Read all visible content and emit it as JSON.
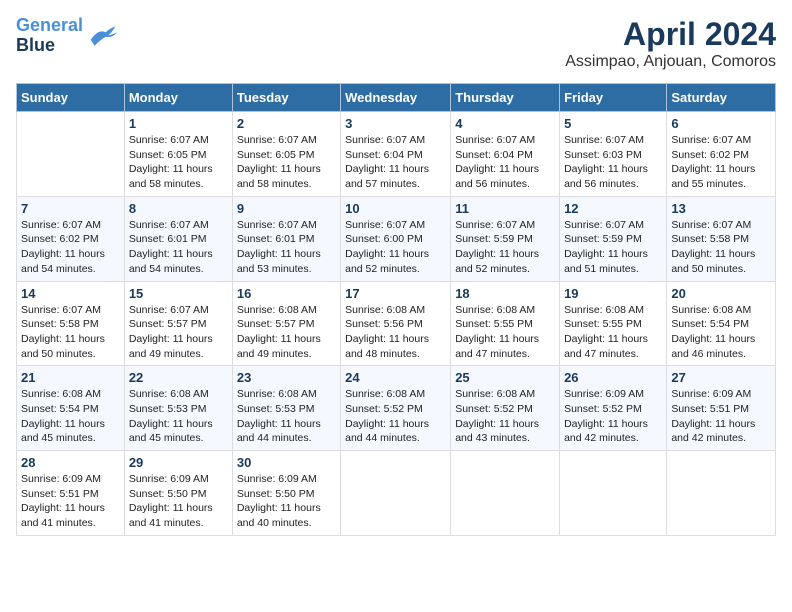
{
  "logo": {
    "line1": "General",
    "line2": "Blue"
  },
  "title": "April 2024",
  "subtitle": "Assimpao, Anjouan, Comoros",
  "days_of_week": [
    "Sunday",
    "Monday",
    "Tuesday",
    "Wednesday",
    "Thursday",
    "Friday",
    "Saturday"
  ],
  "weeks": [
    [
      {
        "day": "",
        "sunrise": "",
        "sunset": "",
        "daylight": ""
      },
      {
        "day": "1",
        "sunrise": "Sunrise: 6:07 AM",
        "sunset": "Sunset: 6:05 PM",
        "daylight": "Daylight: 11 hours and 58 minutes."
      },
      {
        "day": "2",
        "sunrise": "Sunrise: 6:07 AM",
        "sunset": "Sunset: 6:05 PM",
        "daylight": "Daylight: 11 hours and 58 minutes."
      },
      {
        "day": "3",
        "sunrise": "Sunrise: 6:07 AM",
        "sunset": "Sunset: 6:04 PM",
        "daylight": "Daylight: 11 hours and 57 minutes."
      },
      {
        "day": "4",
        "sunrise": "Sunrise: 6:07 AM",
        "sunset": "Sunset: 6:04 PM",
        "daylight": "Daylight: 11 hours and 56 minutes."
      },
      {
        "day": "5",
        "sunrise": "Sunrise: 6:07 AM",
        "sunset": "Sunset: 6:03 PM",
        "daylight": "Daylight: 11 hours and 56 minutes."
      },
      {
        "day": "6",
        "sunrise": "Sunrise: 6:07 AM",
        "sunset": "Sunset: 6:02 PM",
        "daylight": "Daylight: 11 hours and 55 minutes."
      }
    ],
    [
      {
        "day": "7",
        "sunrise": "Sunrise: 6:07 AM",
        "sunset": "Sunset: 6:02 PM",
        "daylight": "Daylight: 11 hours and 54 minutes."
      },
      {
        "day": "8",
        "sunrise": "Sunrise: 6:07 AM",
        "sunset": "Sunset: 6:01 PM",
        "daylight": "Daylight: 11 hours and 54 minutes."
      },
      {
        "day": "9",
        "sunrise": "Sunrise: 6:07 AM",
        "sunset": "Sunset: 6:01 PM",
        "daylight": "Daylight: 11 hours and 53 minutes."
      },
      {
        "day": "10",
        "sunrise": "Sunrise: 6:07 AM",
        "sunset": "Sunset: 6:00 PM",
        "daylight": "Daylight: 11 hours and 52 minutes."
      },
      {
        "day": "11",
        "sunrise": "Sunrise: 6:07 AM",
        "sunset": "Sunset: 5:59 PM",
        "daylight": "Daylight: 11 hours and 52 minutes."
      },
      {
        "day": "12",
        "sunrise": "Sunrise: 6:07 AM",
        "sunset": "Sunset: 5:59 PM",
        "daylight": "Daylight: 11 hours and 51 minutes."
      },
      {
        "day": "13",
        "sunrise": "Sunrise: 6:07 AM",
        "sunset": "Sunset: 5:58 PM",
        "daylight": "Daylight: 11 hours and 50 minutes."
      }
    ],
    [
      {
        "day": "14",
        "sunrise": "Sunrise: 6:07 AM",
        "sunset": "Sunset: 5:58 PM",
        "daylight": "Daylight: 11 hours and 50 minutes."
      },
      {
        "day": "15",
        "sunrise": "Sunrise: 6:07 AM",
        "sunset": "Sunset: 5:57 PM",
        "daylight": "Daylight: 11 hours and 49 minutes."
      },
      {
        "day": "16",
        "sunrise": "Sunrise: 6:08 AM",
        "sunset": "Sunset: 5:57 PM",
        "daylight": "Daylight: 11 hours and 49 minutes."
      },
      {
        "day": "17",
        "sunrise": "Sunrise: 6:08 AM",
        "sunset": "Sunset: 5:56 PM",
        "daylight": "Daylight: 11 hours and 48 minutes."
      },
      {
        "day": "18",
        "sunrise": "Sunrise: 6:08 AM",
        "sunset": "Sunset: 5:55 PM",
        "daylight": "Daylight: 11 hours and 47 minutes."
      },
      {
        "day": "19",
        "sunrise": "Sunrise: 6:08 AM",
        "sunset": "Sunset: 5:55 PM",
        "daylight": "Daylight: 11 hours and 47 minutes."
      },
      {
        "day": "20",
        "sunrise": "Sunrise: 6:08 AM",
        "sunset": "Sunset: 5:54 PM",
        "daylight": "Daylight: 11 hours and 46 minutes."
      }
    ],
    [
      {
        "day": "21",
        "sunrise": "Sunrise: 6:08 AM",
        "sunset": "Sunset: 5:54 PM",
        "daylight": "Daylight: 11 hours and 45 minutes."
      },
      {
        "day": "22",
        "sunrise": "Sunrise: 6:08 AM",
        "sunset": "Sunset: 5:53 PM",
        "daylight": "Daylight: 11 hours and 45 minutes."
      },
      {
        "day": "23",
        "sunrise": "Sunrise: 6:08 AM",
        "sunset": "Sunset: 5:53 PM",
        "daylight": "Daylight: 11 hours and 44 minutes."
      },
      {
        "day": "24",
        "sunrise": "Sunrise: 6:08 AM",
        "sunset": "Sunset: 5:52 PM",
        "daylight": "Daylight: 11 hours and 44 minutes."
      },
      {
        "day": "25",
        "sunrise": "Sunrise: 6:08 AM",
        "sunset": "Sunset: 5:52 PM",
        "daylight": "Daylight: 11 hours and 43 minutes."
      },
      {
        "day": "26",
        "sunrise": "Sunrise: 6:09 AM",
        "sunset": "Sunset: 5:52 PM",
        "daylight": "Daylight: 11 hours and 42 minutes."
      },
      {
        "day": "27",
        "sunrise": "Sunrise: 6:09 AM",
        "sunset": "Sunset: 5:51 PM",
        "daylight": "Daylight: 11 hours and 42 minutes."
      }
    ],
    [
      {
        "day": "28",
        "sunrise": "Sunrise: 6:09 AM",
        "sunset": "Sunset: 5:51 PM",
        "daylight": "Daylight: 11 hours and 41 minutes."
      },
      {
        "day": "29",
        "sunrise": "Sunrise: 6:09 AM",
        "sunset": "Sunset: 5:50 PM",
        "daylight": "Daylight: 11 hours and 41 minutes."
      },
      {
        "day": "30",
        "sunrise": "Sunrise: 6:09 AM",
        "sunset": "Sunset: 5:50 PM",
        "daylight": "Daylight: 11 hours and 40 minutes."
      },
      {
        "day": "",
        "sunrise": "",
        "sunset": "",
        "daylight": ""
      },
      {
        "day": "",
        "sunrise": "",
        "sunset": "",
        "daylight": ""
      },
      {
        "day": "",
        "sunrise": "",
        "sunset": "",
        "daylight": ""
      },
      {
        "day": "",
        "sunrise": "",
        "sunset": "",
        "daylight": ""
      }
    ]
  ]
}
